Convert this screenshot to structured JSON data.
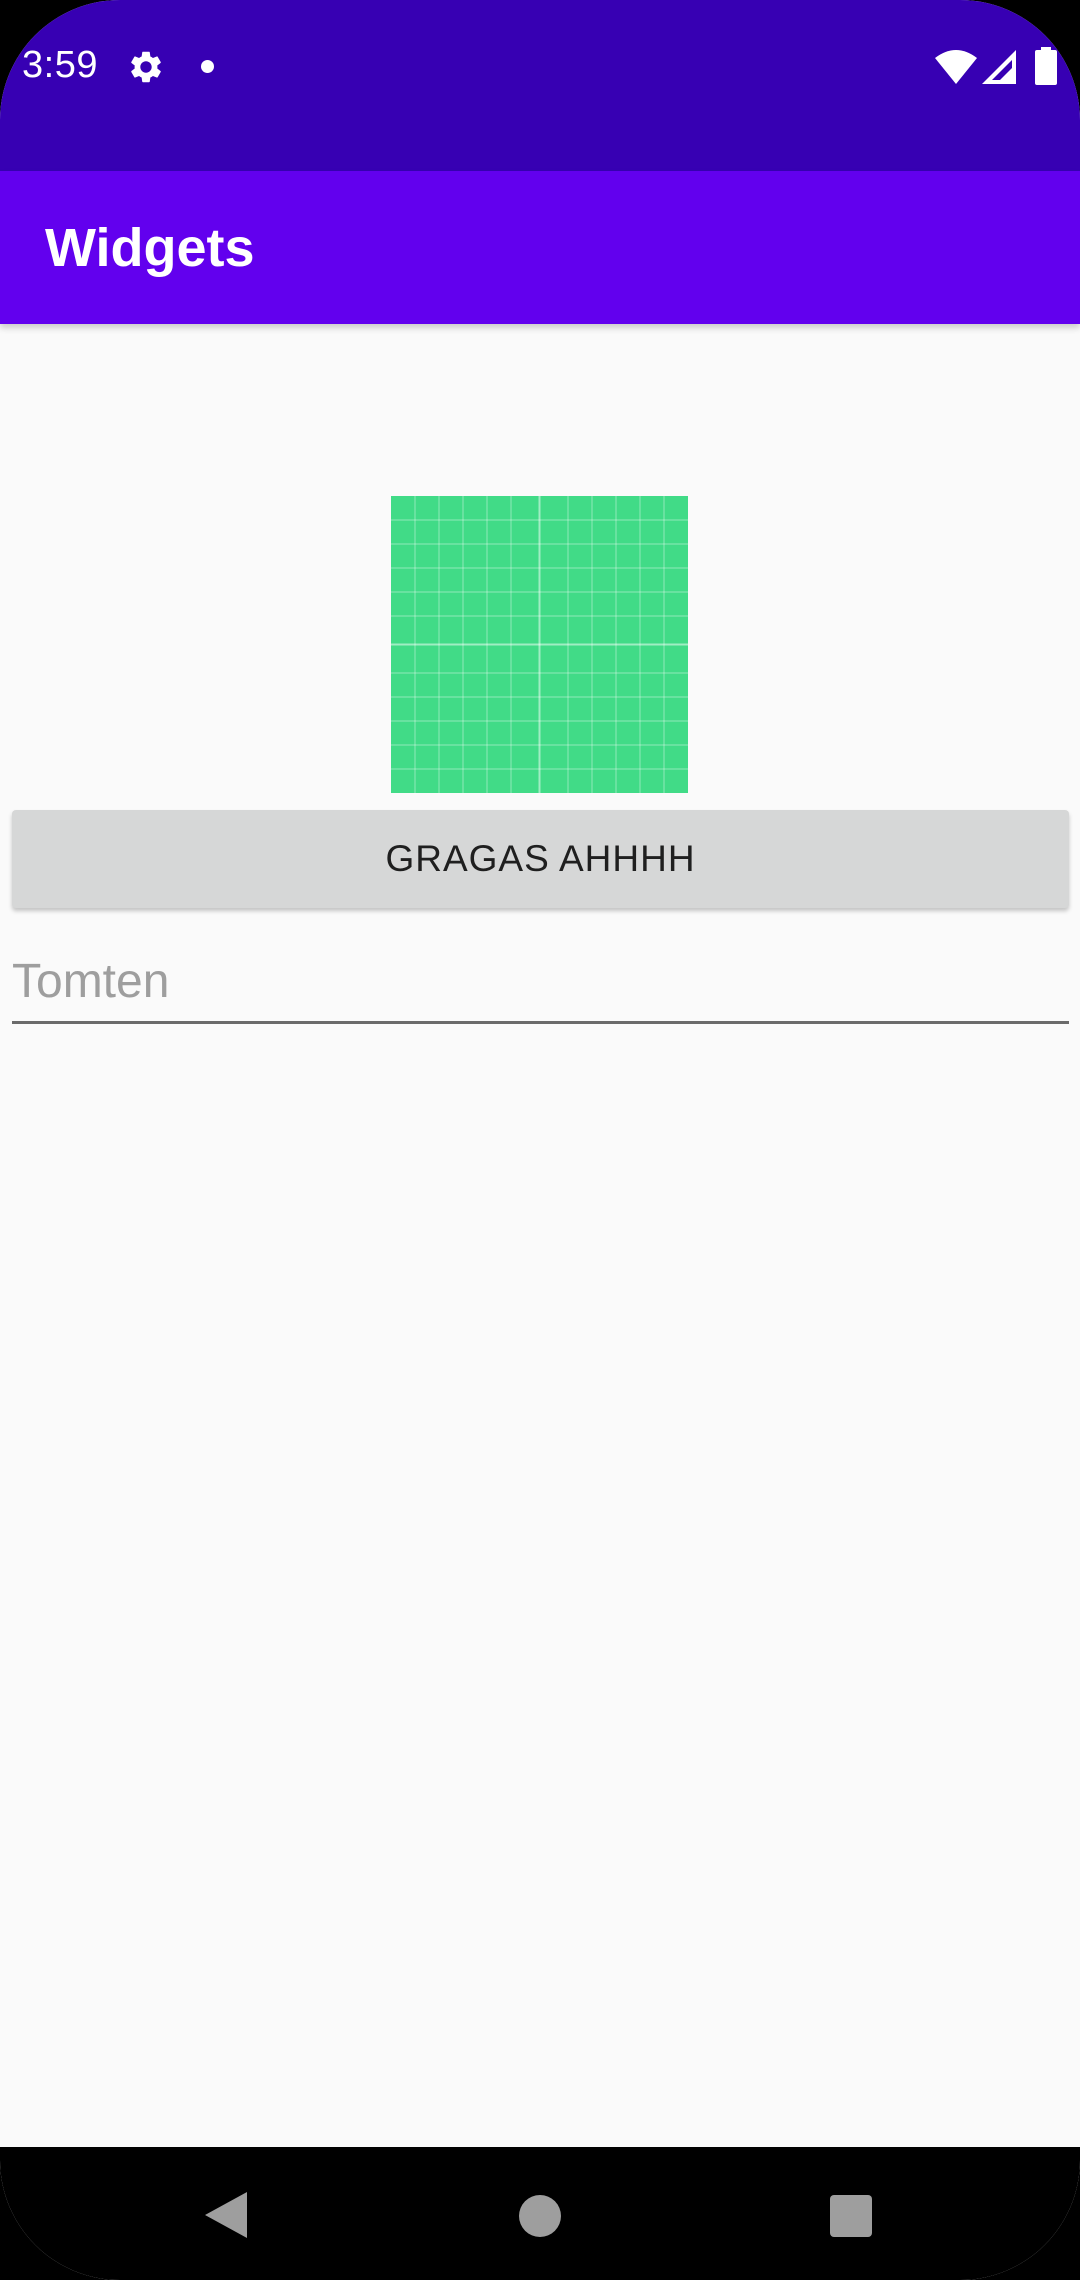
{
  "status_bar": {
    "time": "3:59",
    "icons": [
      "gear-icon",
      "notification-dot-icon",
      "wifi-icon",
      "signal-icon",
      "battery-icon"
    ],
    "background_color": "#3700b3"
  },
  "app_bar": {
    "title": "Widgets",
    "background_color": "#6200ee"
  },
  "main": {
    "image": {
      "icon": "green-grid-image",
      "color": "#41db87"
    },
    "button": {
      "label": "GRAGAS AHHHH"
    },
    "edit_text": {
      "value": "",
      "placeholder": "Tomten"
    }
  },
  "nav_bar": {
    "icons": [
      "back-icon",
      "home-icon",
      "recents-icon"
    ]
  }
}
